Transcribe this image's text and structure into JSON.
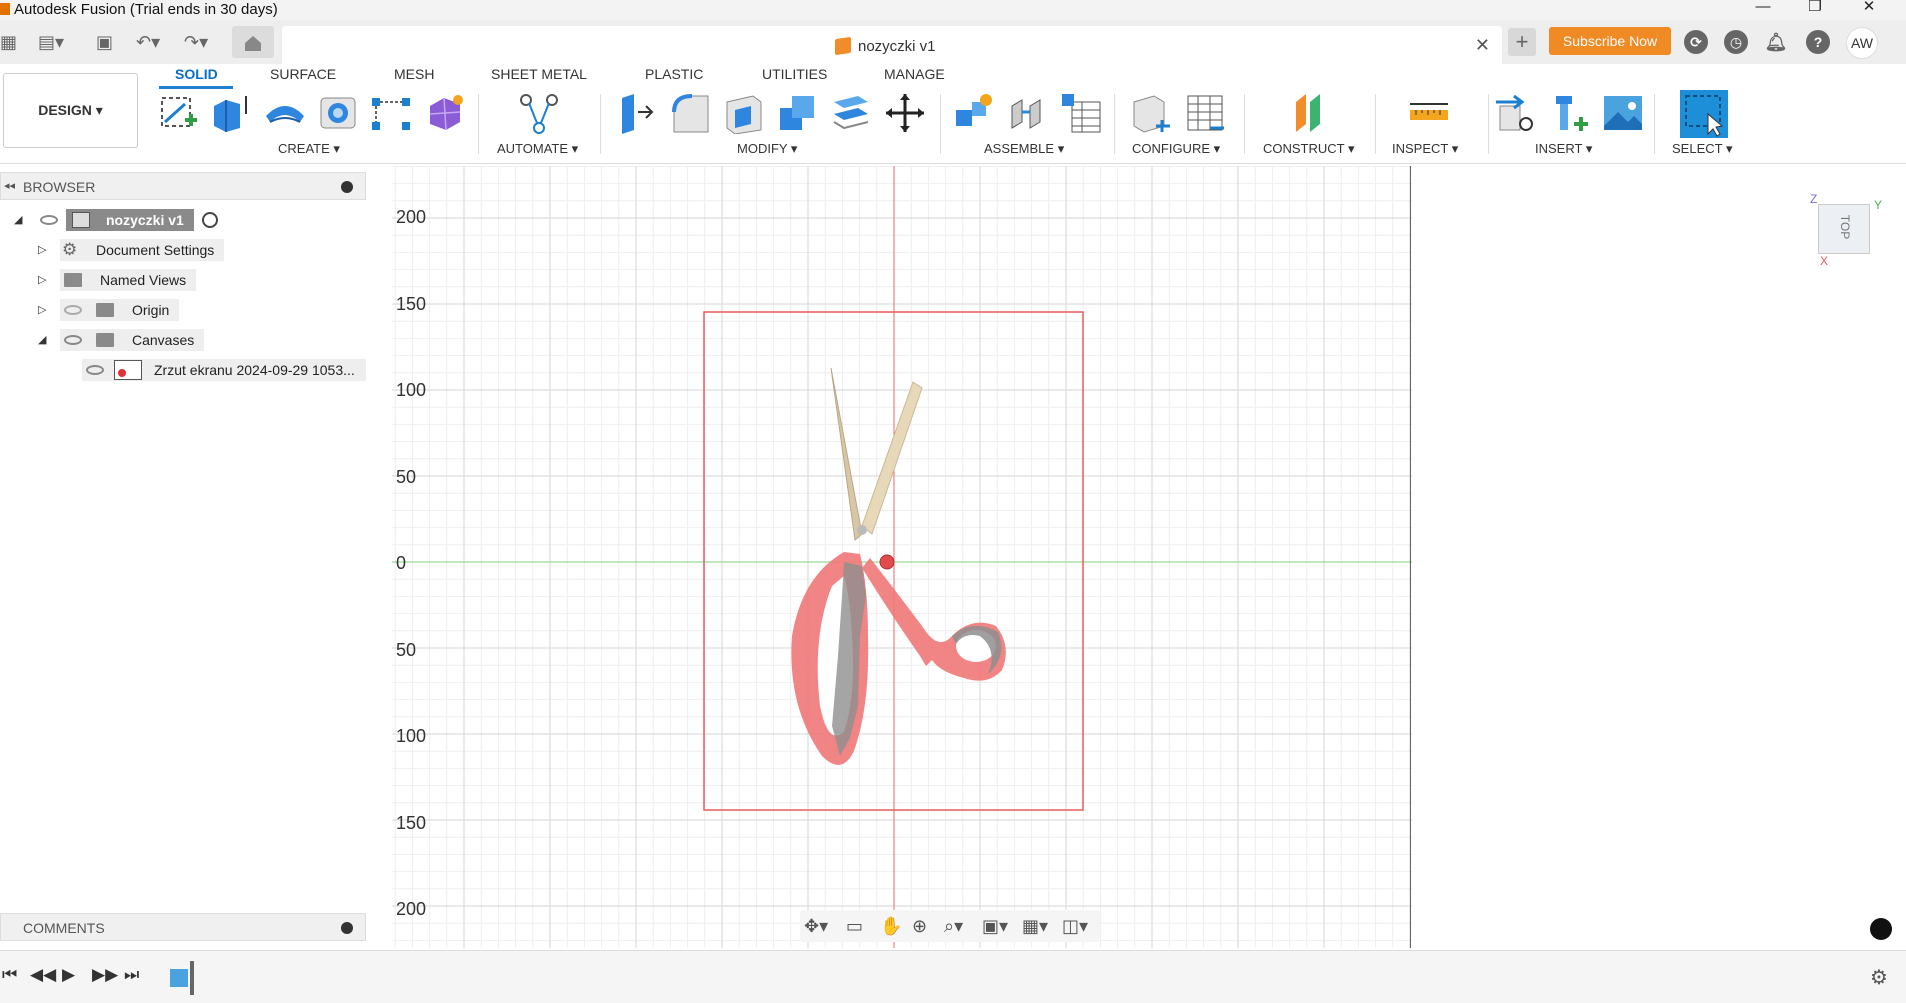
{
  "window": {
    "title": "Autodesk Fusion (Trial ends in 30 days)",
    "minimize": "—",
    "restore": "❐",
    "close": "✕"
  },
  "tabbar": {
    "document_title": "nozyczki v1",
    "close": "✕",
    "add": "+",
    "subscribe": "Subscribe Now",
    "help": "?",
    "user_initials": "AW"
  },
  "toolbar": {
    "workspace": "DESIGN ▾",
    "tabs": [
      "SOLID",
      "SURFACE",
      "MESH",
      "SHEET METAL",
      "PLASTIC",
      "UTILITIES",
      "MANAGE"
    ],
    "groups": [
      "CREATE ▾",
      "AUTOMATE ▾",
      "MODIFY ▾",
      "ASSEMBLE ▾",
      "CONFIGURE ▾",
      "CONSTRUCT ▾",
      "INSPECT ▾",
      "INSERT ▾",
      "SELECT ▾"
    ]
  },
  "browser": {
    "title": "BROWSER",
    "items": [
      {
        "label": "nozyczki v1"
      },
      {
        "label": "Document Settings"
      },
      {
        "label": "Named Views"
      },
      {
        "label": "Origin"
      },
      {
        "label": "Canvases"
      },
      {
        "label": "Zrzut ekranu 2024-09-29 1053..."
      }
    ]
  },
  "comments": {
    "title": "COMMENTS"
  },
  "viewport": {
    "axis_ticks": [
      "200",
      "150",
      "100",
      "50",
      "0",
      "50",
      "100",
      "150",
      "200"
    ],
    "view_cube_face": "TOP",
    "axes": {
      "z": "Z",
      "y": "Y",
      "x": "X"
    }
  },
  "colors": {
    "accent": "#1d7fd0",
    "subscribe": "#f08a24",
    "canvas_border": "#e85a5a",
    "x_axis": "#7fd27f",
    "y_axis": "#e86a6a"
  }
}
